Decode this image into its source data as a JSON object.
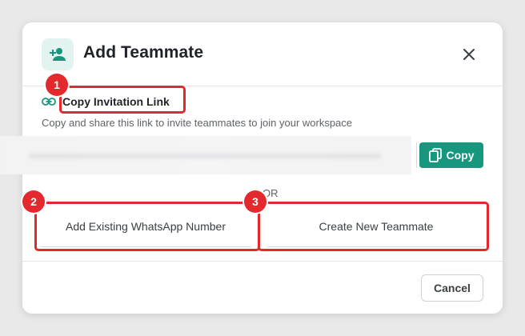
{
  "dialog": {
    "title": "Add Teammate",
    "header_icon": "person-add-icon",
    "close_icon": "close-icon"
  },
  "invite": {
    "label": "Copy Invitation Link",
    "link_icon": "link-icon",
    "description": "Copy and share this link to invite teammates to join your workspace",
    "copy_button": "Copy",
    "copy_icon": "copy-icon"
  },
  "divider_text": "OR",
  "options": {
    "existing": "Add Existing WhatsApp Number",
    "new": "Create New Teammate"
  },
  "footer": {
    "cancel": "Cancel"
  },
  "annotations": [
    "1",
    "2",
    "3"
  ],
  "colors": {
    "accent": "#16977e",
    "annotation": "#e3282e",
    "icon_bg": "#e3f3f0"
  }
}
